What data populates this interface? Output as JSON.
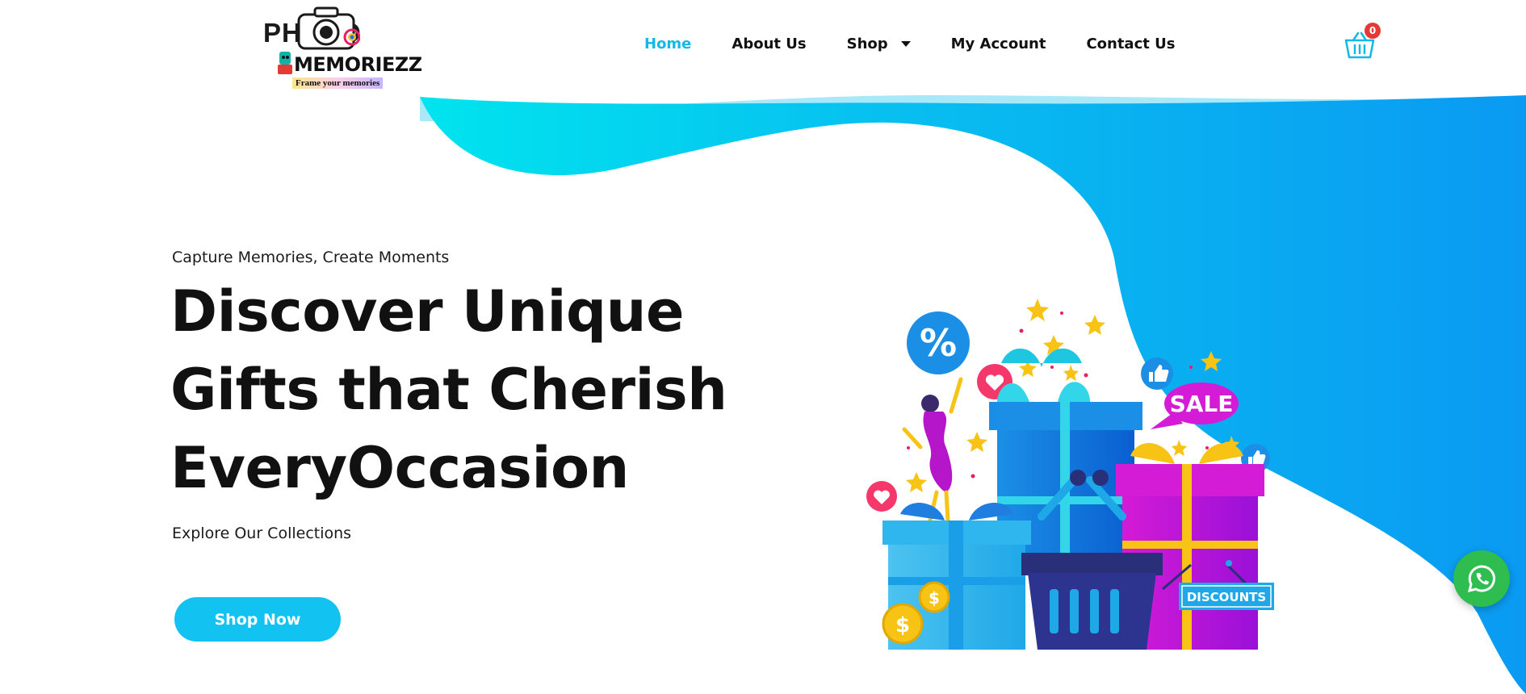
{
  "brand": {
    "logo_text_top": "PHOTO",
    "logo_text_main": "MEMORIEZZ",
    "tagline": "Frame your memories"
  },
  "nav": {
    "items": [
      {
        "label": "Home",
        "active": true
      },
      {
        "label": "About Us"
      },
      {
        "label": "Shop",
        "has_dropdown": true
      },
      {
        "label": "My Account"
      },
      {
        "label": "Contact Us"
      }
    ]
  },
  "cart": {
    "count": "0",
    "icon": "basket-icon"
  },
  "hero": {
    "eyebrow": "Capture Memories, Create Moments",
    "headline_lines": [
      "Discover Unique",
      "Gifts that Cherish",
      "EveryOccasion"
    ],
    "subtitle": "Explore Our Collections",
    "cta_label": "Shop Now"
  },
  "illustration": {
    "sale_label": "SALE",
    "discount_label": "DISCOUNTS",
    "percent_symbol": "%",
    "coin_symbol": "$"
  },
  "whatsapp": {
    "icon": "whatsapp-icon"
  },
  "colors": {
    "accent": "#12c3f2",
    "wave_start": "#00e0ee",
    "wave_end": "#0a9cf2",
    "badge": "#e53935",
    "whatsapp": "#2ebd4e"
  }
}
